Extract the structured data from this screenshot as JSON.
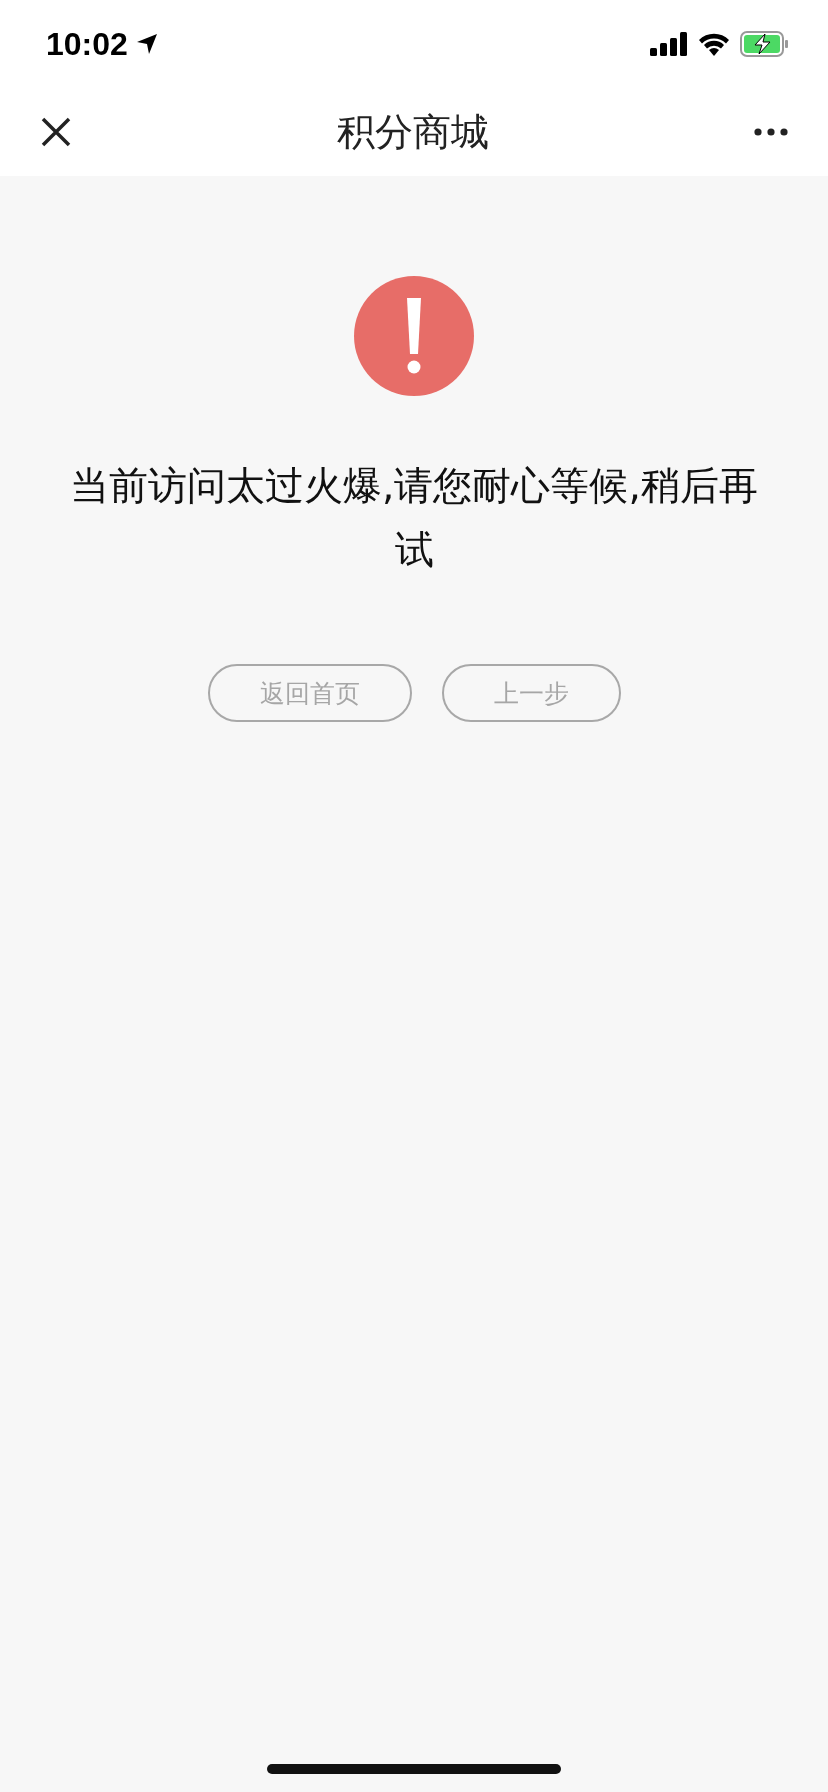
{
  "status_bar": {
    "time": "10:02"
  },
  "nav_bar": {
    "title": "积分商城"
  },
  "error": {
    "message": "当前访问太过火爆,请您耐心等候,稍后再试"
  },
  "buttons": [
    {
      "label": "返回首页"
    },
    {
      "label": "上一步"
    }
  ]
}
